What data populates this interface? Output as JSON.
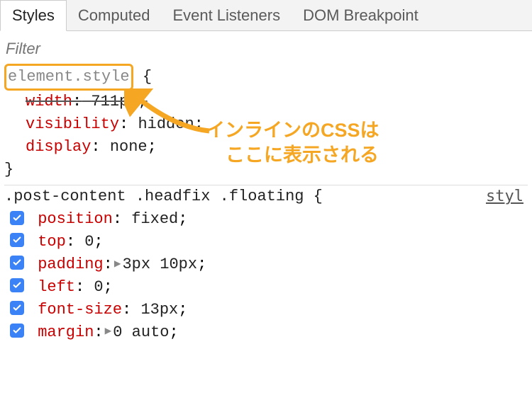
{
  "tabs": {
    "styles": "Styles",
    "computed": "Computed",
    "eventListeners": "Event Listeners",
    "domBreakpoints": "DOM Breakpoint"
  },
  "filter": {
    "placeholder": "Filter"
  },
  "rule1": {
    "selector": "element.style",
    "openBrace": "{",
    "closeBrace": "}",
    "props": {
      "width": {
        "name": "width",
        "value": "711px",
        "struck": true
      },
      "visibility": {
        "name": "visibility",
        "value": "hidden"
      },
      "display": {
        "name": "display",
        "value": "none"
      }
    }
  },
  "rule2": {
    "selector": ".post-content .headfix .floating",
    "openBrace": "{",
    "sourceLink": "styl",
    "props": {
      "position": {
        "name": "position",
        "value": "fixed"
      },
      "top": {
        "name": "top",
        "value": "0"
      },
      "padding": {
        "name": "padding",
        "value": "3px 10px"
      },
      "left": {
        "name": "left",
        "value": "0"
      },
      "fontSize": {
        "name": "font-size",
        "value": "13px"
      },
      "margin": {
        "name": "margin",
        "value": "0 auto"
      }
    }
  },
  "annotation": {
    "line1": "インラインのCSSは",
    "line2": "ここに表示される"
  },
  "punct": {
    "colon": ":",
    "semicolon": ";"
  }
}
